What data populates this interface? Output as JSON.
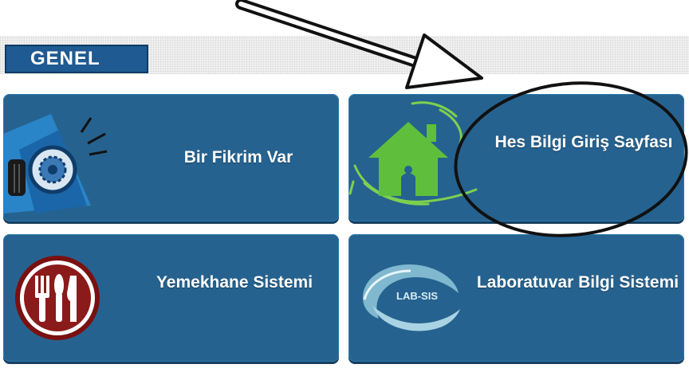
{
  "section": {
    "title": "GENEL"
  },
  "tiles": [
    {
      "label": "Bir Fikrim Var",
      "icon": "megaphone-icon"
    },
    {
      "label": "Hes Bilgi Giriş Sayfası",
      "icon": "house-in-hands-icon"
    },
    {
      "label": "Yemekhane Sistemi",
      "icon": "cutlery-icon"
    },
    {
      "label": "Laboratuvar Bilgi Sistemi",
      "icon": "lab-logo-icon"
    }
  ],
  "logo_text": "LAB-SIS",
  "colors": {
    "tile_bg": "#26628f",
    "section_bg": "#1f5a92",
    "house_green": "#5fbf3c",
    "cutlery_red": "#8b1a1a"
  }
}
